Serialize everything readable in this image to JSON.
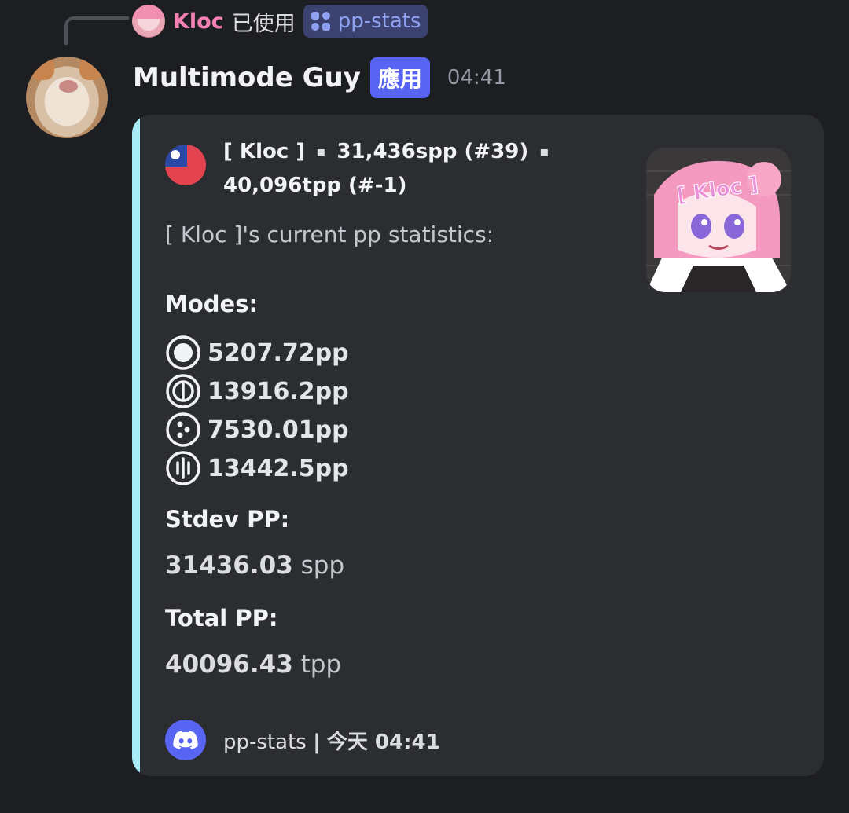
{
  "reply": {
    "user": "Kloc",
    "action": "已使用",
    "command": "pp-stats",
    "command_icon": "slash-command-icon"
  },
  "message": {
    "author": "Multimode Guy",
    "badge": "應用",
    "time": "04:41"
  },
  "embed": {
    "accent_color": "#a8ecf7",
    "author_name": "[ Kloc ]",
    "author_spp": "31,436spp (#39)",
    "author_tpp": "40,096tpp (#-1)",
    "separator": "▪",
    "flag_icon": "taiwan-flag-icon",
    "thumbnail_text": "[ Kloc ]",
    "description": "[ Kloc ]'s current pp statistics:",
    "modes_title": "Modes:",
    "modes": [
      {
        "icon": "osu-standard-icon",
        "value": "5207.72pp"
      },
      {
        "icon": "osu-taiko-icon",
        "value": "13916.2pp"
      },
      {
        "icon": "osu-catch-icon",
        "value": "7530.01pp"
      },
      {
        "icon": "osu-mania-icon",
        "value": "13442.5pp"
      }
    ],
    "stdev_title": "Stdev PP:",
    "stdev_value": "31436.03",
    "stdev_unit": "spp",
    "total_title": "Total PP:",
    "total_value": "40096.43",
    "total_unit": "tpp",
    "footer_app": "pp-stats",
    "footer_sep": "|",
    "footer_time": "今天 04:41"
  }
}
